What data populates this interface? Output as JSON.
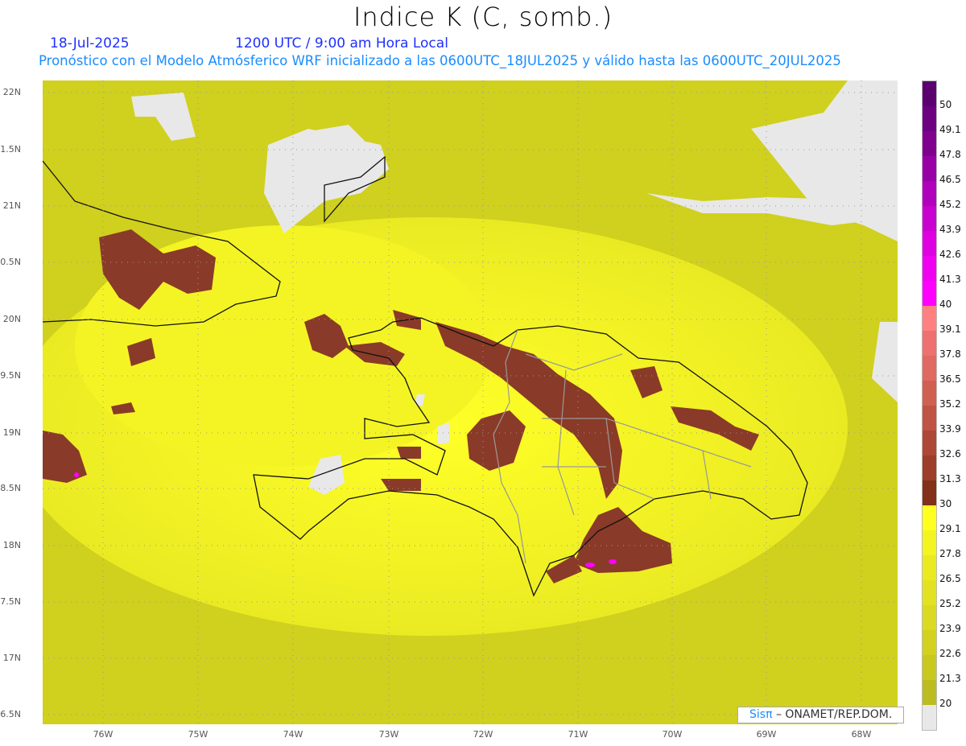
{
  "header": {
    "title": "Indice K (C, somb.)",
    "date": "18-Jul-2025",
    "time": "1200 UTC / 9:00 am Hora Local",
    "subtitle": "Pronóstico con el Modelo Atmósferico WRF inicializado a las 0600UTC_18JUL2025 y válido hasta las  0600UTC_20JUL2025"
  },
  "map": {
    "lat_labels": [
      "22N",
      "1.5N",
      "21N",
      "0.5N",
      "20N",
      "9.5N",
      "19N",
      "8.5N",
      "18N",
      "7.5N",
      "17N",
      "6.5N"
    ],
    "lon_labels": [
      "76W",
      "75W",
      "74W",
      "73W",
      "72W",
      "71W",
      "70W",
      "69W",
      "68W"
    ],
    "ocean_color": "#d4d420",
    "land_color": "#e8e8e8",
    "high_k_color": "#8a3a28"
  },
  "colorbar": {
    "labels": [
      "50",
      "49.1",
      "47.8",
      "46.5",
      "45.2",
      "43.9",
      "42.6",
      "41.3",
      "40",
      "39.1",
      "37.8",
      "36.5",
      "35.2",
      "33.9",
      "32.6",
      "31.3",
      "30",
      "29.1",
      "27.8",
      "26.5",
      "25.2",
      "23.9",
      "22.6",
      "21.3",
      "20"
    ],
    "colors": [
      "#5c0070",
      "#6c0080",
      "#80008e",
      "#9800a6",
      "#b000bc",
      "#c800d0",
      "#de00e0",
      "#f000f0",
      "#ff00ff",
      "#ff8080",
      "#ee7070",
      "#e06a62",
      "#d06050",
      "#bf5444",
      "#ae4836",
      "#9c3e2a",
      "#82301a",
      "#ffff20",
      "#f4f420",
      "#eaea20",
      "#e2e220",
      "#dada20",
      "#d2d21e",
      "#c8c81e",
      "#bcbc20",
      "#e8e8e8"
    ]
  },
  "credit": {
    "brand": "Sisπ",
    "text": " – ONAMET/REP.DOM."
  }
}
